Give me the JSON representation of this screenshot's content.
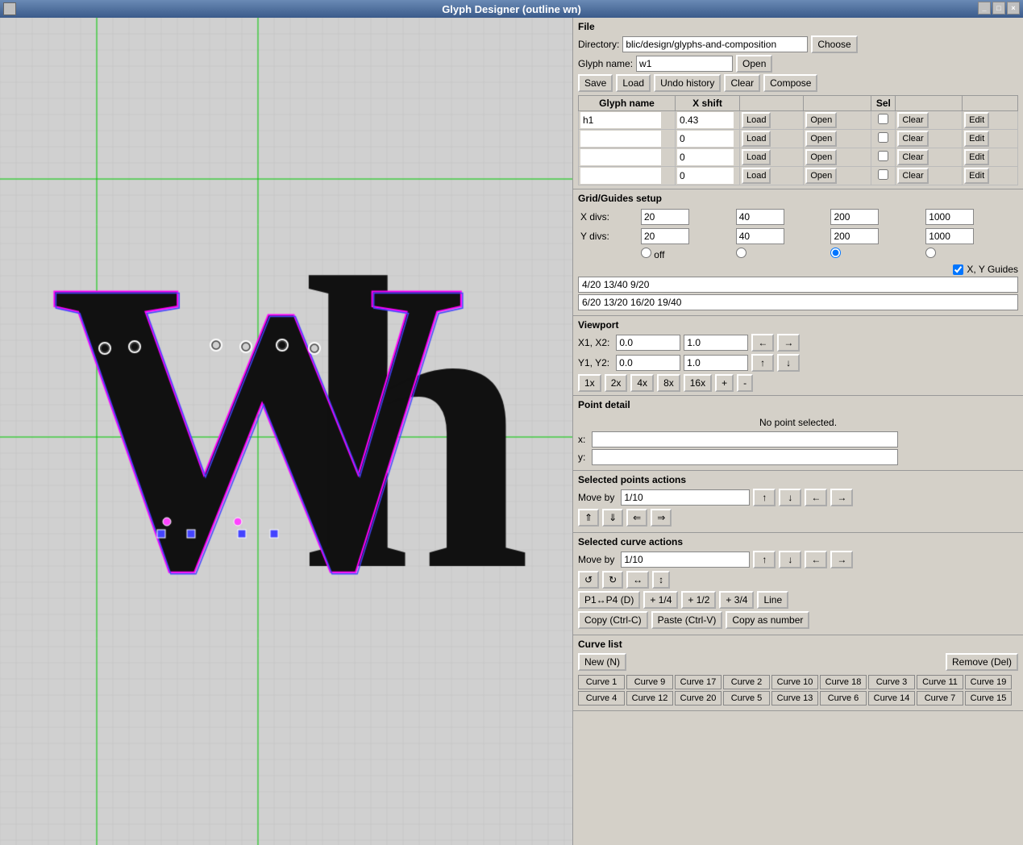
{
  "window": {
    "title": "Glyph Designer (outline wn)"
  },
  "file_section": {
    "title": "File",
    "directory_label": "Directory:",
    "directory_value": "blic/design/glyphs-and-composition",
    "choose_label": "Choose",
    "glyph_name_label": "Glyph name:",
    "glyph_name_value": "w1",
    "open_label": "Open",
    "save_label": "Save",
    "load_label": "Load",
    "undo_history_label": "Undo history",
    "clear_label": "Clear",
    "compose_label": "Compose"
  },
  "glyph_table": {
    "col_glyph_name": "Glyph name",
    "col_x_shift": "X shift",
    "col_sel": "Sel",
    "rows": [
      {
        "name": "h1",
        "xshift": "0.43",
        "sel": false
      },
      {
        "name": "",
        "xshift": "0",
        "sel": false
      },
      {
        "name": "",
        "xshift": "0",
        "sel": false
      },
      {
        "name": "",
        "xshift": "0",
        "sel": false
      }
    ]
  },
  "grid_section": {
    "title": "Grid/Guides setup",
    "x_divs_label": "X divs:",
    "y_divs_label": "Y divs:",
    "x_divs_values": [
      "20",
      "40",
      "200",
      "1000"
    ],
    "y_divs_values": [
      "20",
      "40",
      "200",
      "1000"
    ],
    "radio_options": [
      "off",
      "",
      "",
      "",
      ""
    ],
    "xy_guides_label": "X, Y Guides",
    "guide_lines": [
      "4/20 13/40 9/20",
      "6/20 13/20 16/20  19/40"
    ]
  },
  "viewport_section": {
    "title": "Viewport",
    "x1x2_label": "X1, X2:",
    "x1_value": "0.0",
    "x2_value": "1.0",
    "y1y2_label": "Y1, Y2:",
    "y1_value": "0.0",
    "y2_value": "1.0",
    "zoom_buttons": [
      "1x",
      "2x",
      "4x",
      "8x",
      "16x",
      "+",
      "-"
    ],
    "arrow_left": "←",
    "arrow_right": "→",
    "arrow_up": "↑",
    "arrow_down": "↓"
  },
  "point_detail_section": {
    "title": "Point detail",
    "no_point_text": "No point selected.",
    "x_label": "x:",
    "y_label": "y:",
    "x_value": "",
    "y_value": ""
  },
  "selected_points_section": {
    "title": "Selected points actions",
    "move_by_label": "Move by",
    "move_by_value": "1/10",
    "up": "↑",
    "down": "↓",
    "left": "←",
    "right": "→",
    "double_up": "⇑",
    "double_down": "⇓",
    "align_left": "⇐",
    "align_right": "⇒"
  },
  "selected_curve_section": {
    "title": "Selected curve actions",
    "move_by_label": "Move by",
    "move_by_value": "1/10",
    "up": "↑",
    "down": "↓",
    "left": "←",
    "right": "→",
    "btn_ccw": "↺",
    "btn_cw": "↻",
    "btn_flip_h": "↔",
    "btn_flip_v": "↕",
    "p1p4_label": "P1↔P4 (D)",
    "plus_1_4": "+ 1/4",
    "plus_1_2": "+ 1/2",
    "plus_3_4": "+ 3/4",
    "line_label": "Line",
    "copy_label": "Copy (Ctrl-C)",
    "paste_label": "Paste (Ctrl-V)",
    "copy_as_number_label": "Copy as number"
  },
  "curve_list_section": {
    "title": "Curve list",
    "new_label": "New (N)",
    "remove_label": "Remove (Del)",
    "curves": [
      "Curve 1",
      "Curve 9",
      "Curve 17",
      "Curve 2",
      "Curve 10",
      "Curve 18",
      "Curve 3",
      "Curve 11",
      "Curve 19",
      "Curve 4",
      "Curve 12",
      "Curve 20",
      "Curve 5",
      "Curve 13",
      "Curve 6",
      "Curve 14",
      "Curve 7",
      "Curve 15"
    ]
  }
}
